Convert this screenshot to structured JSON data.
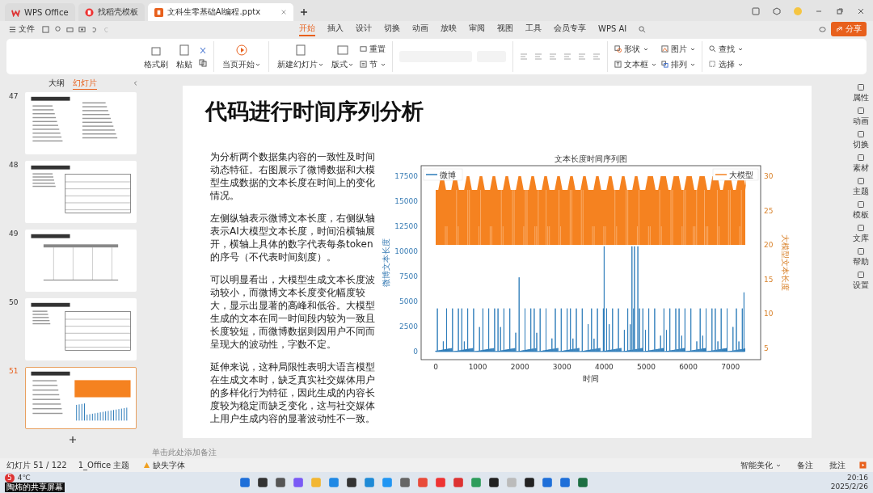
{
  "tabs": [
    {
      "label": "WPS Office",
      "kind": "wps",
      "selected": false
    },
    {
      "label": "找稻壳模板",
      "kind": "docer",
      "selected": false
    },
    {
      "label": "文科生零基础AI编程.pptx",
      "kind": "ppt",
      "selected": true
    }
  ],
  "quick": {
    "file": "文件"
  },
  "menu": [
    {
      "label": "开始",
      "selected": true
    },
    {
      "label": "插入",
      "selected": false
    },
    {
      "label": "设计",
      "selected": false
    },
    {
      "label": "切换",
      "selected": false
    },
    {
      "label": "动画",
      "selected": false
    },
    {
      "label": "放映",
      "selected": false
    },
    {
      "label": "审阅",
      "selected": false
    },
    {
      "label": "视图",
      "selected": false
    },
    {
      "label": "工具",
      "selected": false
    },
    {
      "label": "会员专享",
      "selected": false
    },
    {
      "label": "WPS AI",
      "selected": false
    }
  ],
  "share": "分享",
  "ribbon": {
    "format": "格式刷",
    "paste": "粘贴",
    "play": "当页开始",
    "new_slide": "新建幻灯片",
    "layout": "版式",
    "reset": "重置",
    "section": "节",
    "shape": "形状",
    "picture": "图片",
    "textbox": "文本框",
    "arrange": "排列",
    "find": "查找",
    "select": "选择"
  },
  "panel_tabs": [
    {
      "label": "大纲",
      "selected": false
    },
    {
      "label": "幻灯片",
      "selected": true
    }
  ],
  "slides": [
    {
      "number": "47",
      "kind": "text",
      "selected": false
    },
    {
      "number": "48",
      "kind": "table",
      "selected": false
    },
    {
      "number": "49",
      "kind": "grid",
      "selected": false
    },
    {
      "number": "50",
      "kind": "table",
      "selected": false
    },
    {
      "number": "51",
      "kind": "chart",
      "selected": true
    }
  ],
  "slide": {
    "title": "代码进行时间序列分析",
    "paragraphs": [
      "为分析两个数据集内容的一致性及时间动态特征。右图展示了微博数据和大模型生成数据的文本长度在时间上的变化情况。",
      "左侧纵轴表示微博文本长度，右侧纵轴表示AI大模型文本长度，时间沿横轴展开，横轴上具体的数字代表每条token的序号（不代表时间刻度）。",
      "可以明显看出，大模型生成文本长度波动较小，而微博文本长度变化幅度较大，显示出显著的高峰和低谷。大模型生成的文本在同一时间段内较为一致且长度较短，而微博数据则因用户不同而呈现大的波动性，字数不定。",
      "延伸来说，这种局限性表明大语言模型在生成文本时，缺乏真实社交媒体用户的多样化行为特征，因此生成的内容长度较为稳定而缺乏变化，这与社交媒体上用户生成内容的显著波动性不一致。"
    ],
    "chart": {
      "title": "文本长度时间序列图",
      "xlabel": "时间",
      "ylabel_left": "微博文本长度",
      "ylabel_right": "大模型文本长度",
      "legend_left": "微博",
      "legend_right": "大模型",
      "left_ticks": [
        "17500",
        "15000",
        "12500",
        "10000",
        "7500",
        "5000",
        "2500",
        "0"
      ],
      "right_ticks": [
        "30",
        "25",
        "20",
        "15",
        "10",
        "5"
      ],
      "x_ticks": [
        "0",
        "1000",
        "2000",
        "3000",
        "4000",
        "5000",
        "6000",
        "7000"
      ]
    }
  },
  "side": [
    "属性",
    "动画",
    "切换",
    "素材",
    "主题",
    "模板",
    "文库",
    "帮助",
    "设置"
  ],
  "notes": "单击此处添加备注",
  "status": {
    "slide_count": "幻灯片 51 / 122",
    "theme": "1_Office 主题",
    "fonts": "缺失字体",
    "beautify": "智能美化",
    "notes": "备注",
    "comments": "批注"
  },
  "taskbar": {
    "badge": "5",
    "weather": "4℃",
    "share_label": "陶炜的共享屏幕",
    "time": "20:16",
    "date": "2025/2/26"
  }
}
